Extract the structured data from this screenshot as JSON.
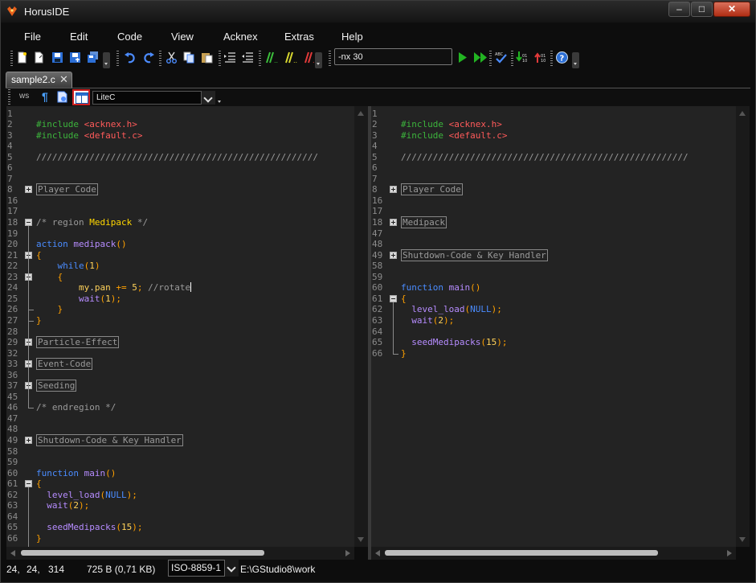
{
  "app": {
    "title": "HorusIDE"
  },
  "window_controls": {
    "minimize": "–",
    "maximize": "□",
    "close": "✕"
  },
  "menu": [
    "File",
    "Edit",
    "Code",
    "View",
    "Acknex",
    "Extras",
    "Help"
  ],
  "toolbar": {
    "args_value": "-nx 30",
    "icons": [
      "new-file-icon",
      "open-file-icon",
      "save-icon",
      "save-as-icon",
      "save-all-icon",
      "undo-icon",
      "redo-icon",
      "cut-icon",
      "copy-icon",
      "paste-icon",
      "indent-icon",
      "outdent-icon",
      "comment-icon",
      "uncomment-icon",
      "toggle-comment-icon",
      "run-icon",
      "run-debug-icon",
      "spellcheck-icon",
      "binary-down-icon",
      "binary-up-icon",
      "help-icon"
    ]
  },
  "tabs": [
    {
      "label": "sample2.c",
      "close": "✕"
    }
  ],
  "editor_toolbar": {
    "ws": "ws",
    "pilcrow": "¶",
    "language": "LiteC"
  },
  "left_pane": {
    "lines": [
      {
        "n": "1",
        "tokens": []
      },
      {
        "n": "2",
        "fold": "line",
        "tokens": [
          [
            "pp",
            "#include "
          ],
          [
            "inc",
            "<acknex.h>"
          ]
        ]
      },
      {
        "n": "3",
        "fold": "line",
        "tokens": [
          [
            "pp",
            "#include "
          ],
          [
            "inc",
            "<default.c>"
          ]
        ]
      },
      {
        "n": "4",
        "tokens": []
      },
      {
        "n": "5",
        "tokens": [
          [
            "cmt",
            "/////////////////////////////////////////////////////"
          ]
        ]
      },
      {
        "n": "6",
        "tokens": []
      },
      {
        "n": "7",
        "tokens": []
      },
      {
        "n": "8",
        "fold": "plus",
        "tokens": [
          [
            "box",
            "Player Code"
          ]
        ]
      },
      {
        "n": "16",
        "tokens": []
      },
      {
        "n": "17",
        "tokens": []
      },
      {
        "n": "18",
        "fold": "minus",
        "tokens": [
          [
            "cmt",
            "/* region "
          ],
          [
            "reg",
            "Medipack"
          ],
          [
            "cmt",
            " */"
          ]
        ]
      },
      {
        "n": "19",
        "tokens": []
      },
      {
        "n": "20",
        "tokens": [
          [
            "kw",
            "action "
          ],
          [
            "fn",
            "medipack"
          ],
          [
            "br",
            "()"
          ]
        ]
      },
      {
        "n": "21",
        "fold": "minus",
        "tokens": [
          [
            "br",
            "{"
          ]
        ]
      },
      {
        "n": "22",
        "tokens": [
          [
            "kw",
            "    while"
          ],
          [
            "br",
            "("
          ],
          [
            "num",
            "1"
          ],
          [
            "br",
            ")"
          ]
        ]
      },
      {
        "n": "23",
        "fold": "minus",
        "tokens": [
          [
            "br",
            "    {"
          ]
        ]
      },
      {
        "n": "24",
        "tokens": [
          [
            "num",
            "        my"
          ],
          [
            "id",
            "."
          ],
          [
            "num",
            "pan"
          ],
          [
            "id",
            " "
          ],
          [
            "br",
            "+="
          ],
          [
            "id",
            " "
          ],
          [
            "num",
            "5"
          ],
          [
            "br",
            ";"
          ],
          [
            "cmt",
            " //rotate"
          ],
          [
            "caret",
            ""
          ]
        ]
      },
      {
        "n": "25",
        "tokens": [
          [
            "fn",
            "        wait"
          ],
          [
            "br",
            "("
          ],
          [
            "num",
            "1"
          ],
          [
            "br",
            ");"
          ]
        ]
      },
      {
        "n": "26",
        "tokens": [
          [
            "br",
            "    }"
          ]
        ]
      },
      {
        "n": "27",
        "tokens": [
          [
            "br",
            "}"
          ]
        ]
      },
      {
        "n": "28",
        "tokens": []
      },
      {
        "n": "29",
        "fold": "plus",
        "tokens": [
          [
            "box",
            "Particle-Effect"
          ]
        ]
      },
      {
        "n": "32",
        "tokens": []
      },
      {
        "n": "33",
        "fold": "plus",
        "tokens": [
          [
            "box",
            "Event-Code"
          ]
        ]
      },
      {
        "n": "36",
        "tokens": []
      },
      {
        "n": "37",
        "fold": "plus",
        "tokens": [
          [
            "box",
            "Seeding"
          ]
        ]
      },
      {
        "n": "45",
        "tokens": []
      },
      {
        "n": "46",
        "tokens": [
          [
            "cmt",
            "/* endregion */"
          ]
        ]
      },
      {
        "n": "47",
        "tokens": []
      },
      {
        "n": "48",
        "tokens": []
      },
      {
        "n": "49",
        "fold": "plus",
        "tokens": [
          [
            "box",
            "Shutdown-Code & Key Handler"
          ]
        ]
      },
      {
        "n": "58",
        "tokens": []
      },
      {
        "n": "59",
        "tokens": []
      },
      {
        "n": "60",
        "tokens": [
          [
            "kw",
            "function "
          ],
          [
            "fn",
            "main"
          ],
          [
            "br",
            "()"
          ]
        ]
      },
      {
        "n": "61",
        "fold": "minus",
        "tokens": [
          [
            "br",
            "{"
          ]
        ]
      },
      {
        "n": "62",
        "tokens": [
          [
            "fn",
            "  level_load"
          ],
          [
            "br",
            "("
          ],
          [
            "nl",
            "NULL"
          ],
          [
            "br",
            ");"
          ]
        ]
      },
      {
        "n": "63",
        "tokens": [
          [
            "fn",
            "  wait"
          ],
          [
            "br",
            "("
          ],
          [
            "num",
            "2"
          ],
          [
            "br",
            ");"
          ]
        ]
      },
      {
        "n": "64",
        "tokens": []
      },
      {
        "n": "65",
        "tokens": [
          [
            "fn",
            "  seedMedipacks"
          ],
          [
            "br",
            "("
          ],
          [
            "num",
            "15"
          ],
          [
            "br",
            ");"
          ]
        ]
      },
      {
        "n": "66",
        "tokens": [
          [
            "br",
            "}"
          ]
        ]
      }
    ]
  },
  "right_pane": {
    "lines": [
      {
        "n": "1",
        "tokens": []
      },
      {
        "n": "2",
        "tokens": [
          [
            "pp",
            "#include "
          ],
          [
            "inc",
            "<acknex.h>"
          ]
        ]
      },
      {
        "n": "3",
        "tokens": [
          [
            "pp",
            "#include "
          ],
          [
            "inc",
            "<default.c>"
          ]
        ]
      },
      {
        "n": "4",
        "tokens": []
      },
      {
        "n": "5",
        "tokens": [
          [
            "cmt",
            "//////////////////////////////////////////////////////"
          ]
        ]
      },
      {
        "n": "6",
        "tokens": []
      },
      {
        "n": "7",
        "tokens": []
      },
      {
        "n": "8",
        "fold": "plus",
        "tokens": [
          [
            "box",
            "Player Code"
          ]
        ]
      },
      {
        "n": "16",
        "tokens": []
      },
      {
        "n": "17",
        "tokens": []
      },
      {
        "n": "18",
        "fold": "plus",
        "tokens": [
          [
            "box",
            "Medipack"
          ]
        ]
      },
      {
        "n": "47",
        "tokens": []
      },
      {
        "n": "48",
        "tokens": []
      },
      {
        "n": "49",
        "fold": "plus",
        "tokens": [
          [
            "box",
            "Shutdown-Code & Key Handler"
          ]
        ]
      },
      {
        "n": "58",
        "tokens": []
      },
      {
        "n": "59",
        "tokens": []
      },
      {
        "n": "60",
        "tokens": [
          [
            "kw",
            "function "
          ],
          [
            "fn",
            "main"
          ],
          [
            "br",
            "()"
          ]
        ]
      },
      {
        "n": "61",
        "fold": "minus",
        "tokens": [
          [
            "br",
            "{"
          ]
        ]
      },
      {
        "n": "62",
        "tokens": [
          [
            "fn",
            "  level_load"
          ],
          [
            "br",
            "("
          ],
          [
            "nl",
            "NULL"
          ],
          [
            "br",
            ");"
          ]
        ]
      },
      {
        "n": "63",
        "tokens": [
          [
            "fn",
            "  wait"
          ],
          [
            "br",
            "("
          ],
          [
            "num",
            "2"
          ],
          [
            "br",
            ");"
          ]
        ]
      },
      {
        "n": "64",
        "tokens": []
      },
      {
        "n": "65",
        "tokens": [
          [
            "fn",
            "  seedMedipacks"
          ],
          [
            "br",
            "("
          ],
          [
            "num",
            "15"
          ],
          [
            "br",
            ");"
          ]
        ]
      },
      {
        "n": "66",
        "tokens": [
          [
            "br",
            "}"
          ]
        ]
      }
    ]
  },
  "status": {
    "line": "24,",
    "col": "24,",
    "pos": "314",
    "size": "725 B (0,71 KB)",
    "encoding": "ISO-8859-1",
    "path": "E:\\GStudio8\\work"
  },
  "colors": {
    "accent": "#4a8cff",
    "close": "#c0391f",
    "split_highlight": "#d02020"
  }
}
